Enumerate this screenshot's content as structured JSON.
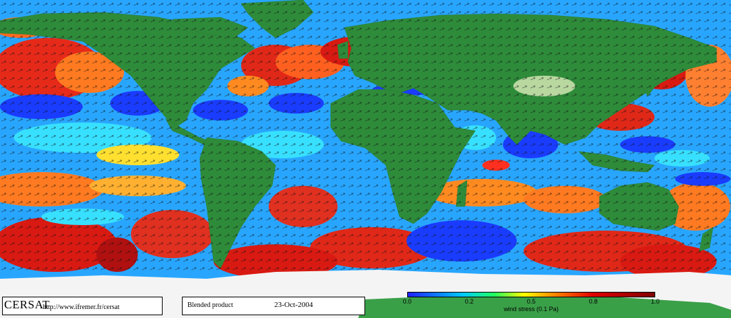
{
  "logo": "CERSAT",
  "url": "http://www.ifremer.fr/cersat",
  "product": "Blended product",
  "date": "23-Oct-2004",
  "colorbar": {
    "label": "wind stress (0.1 Pa)",
    "ticks": [
      "0.0",
      "0.2",
      "0.5",
      "0.8",
      "1.0"
    ],
    "colors": [
      "#2020ff",
      "#00c8ff",
      "#20ff60",
      "#ffff00",
      "#ff8000",
      "#e00000",
      "#800000"
    ]
  },
  "map_colors": {
    "land": "#2e8b3a",
    "ice": "#f4f4f4",
    "ocean_base": "#2aa8ff"
  }
}
